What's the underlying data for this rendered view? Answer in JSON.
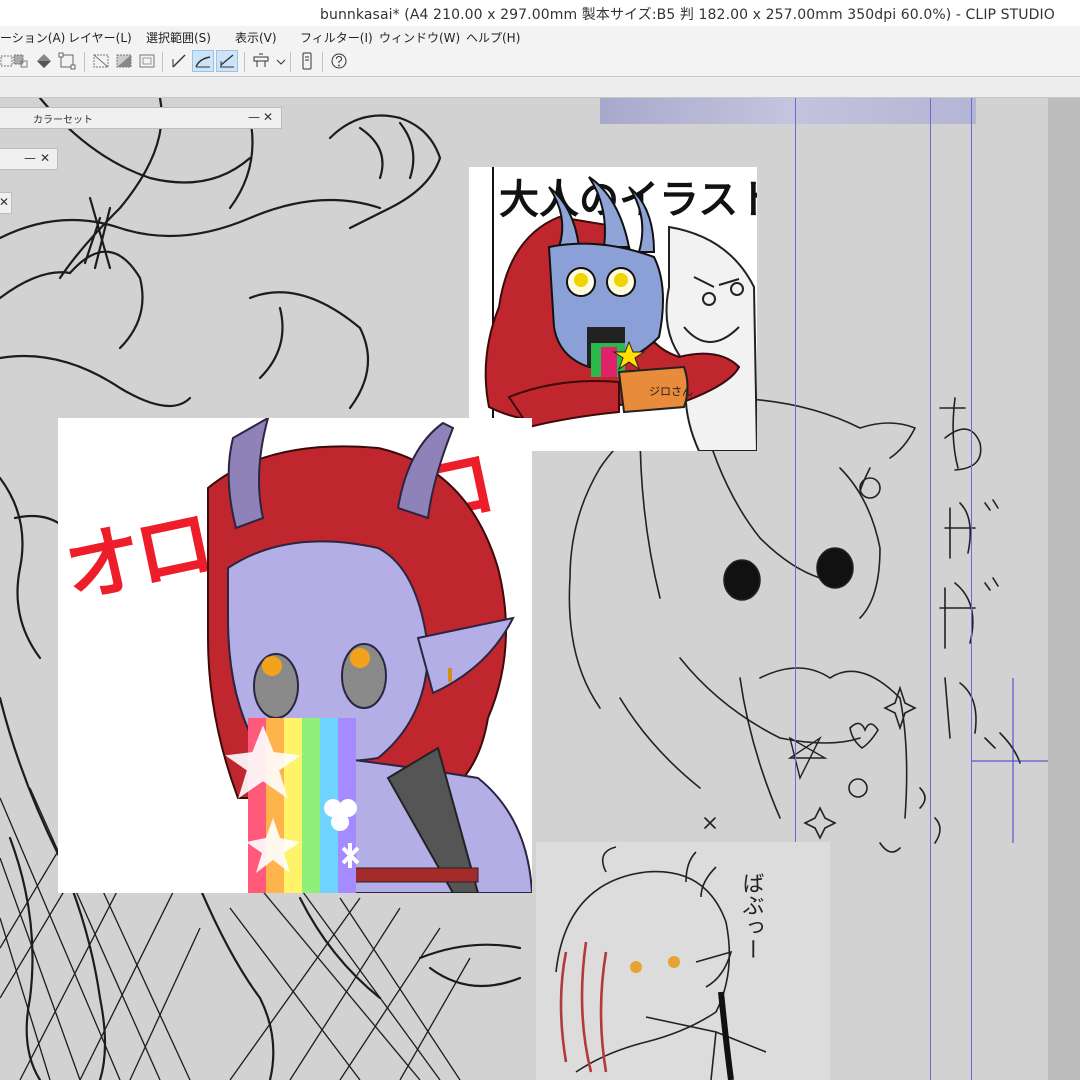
{
  "window": {
    "title": "bunnkasai* (A4 210.00 x 297.00mm 製本サイズ:B5 判 182.00 x 257.00mm 350dpi 60.0%)  - CLIP STUDIO"
  },
  "menu": {
    "items": [
      {
        "label": "ーション(A)"
      },
      {
        "label": "レイヤー(L)"
      },
      {
        "label": "選択範囲(S)"
      },
      {
        "label": "表示(V)"
      },
      {
        "label": "フィルター(I)"
      },
      {
        "label": "ウィンドウ(W)"
      },
      {
        "label": "ヘルプ(H)"
      }
    ]
  },
  "toolbar": {
    "buttons": [
      {
        "icon": "dashed-select-icon"
      },
      {
        "icon": "fill-select-icon"
      },
      {
        "icon": "eraser-diamond-icon"
      },
      {
        "icon": "transform-icon"
      },
      {
        "icon": "deselect-icon"
      },
      {
        "icon": "invert-icon"
      },
      {
        "icon": "border-icon"
      },
      {
        "icon": "ruler-icon"
      },
      {
        "icon": "curve-ruler-icon"
      },
      {
        "icon": "perspective-ruler-icon"
      },
      {
        "icon": "snap-icon"
      },
      {
        "icon": "dropdown-icon"
      },
      {
        "icon": "tablet-icon"
      },
      {
        "icon": "help-icon"
      }
    ]
  },
  "palettes": {
    "color_set": {
      "title": "カラーセット",
      "minimize": "—",
      "close": "✕"
    },
    "small1": {
      "minimize": "—",
      "close": "✕"
    },
    "small2": {
      "close": "✕"
    }
  },
  "artwork": {
    "shout_text": "オロロロロロ",
    "aside_text": "あばばばぁ",
    "burp_text": "ばぶっー",
    "book_title": "大人のイラスト",
    "tag_text": "ジロさん"
  },
  "colors": {
    "hair": "#c0262d",
    "skin": "#b3aee6",
    "guide": "#6b6bd6",
    "shout": "#ee1d2a"
  }
}
